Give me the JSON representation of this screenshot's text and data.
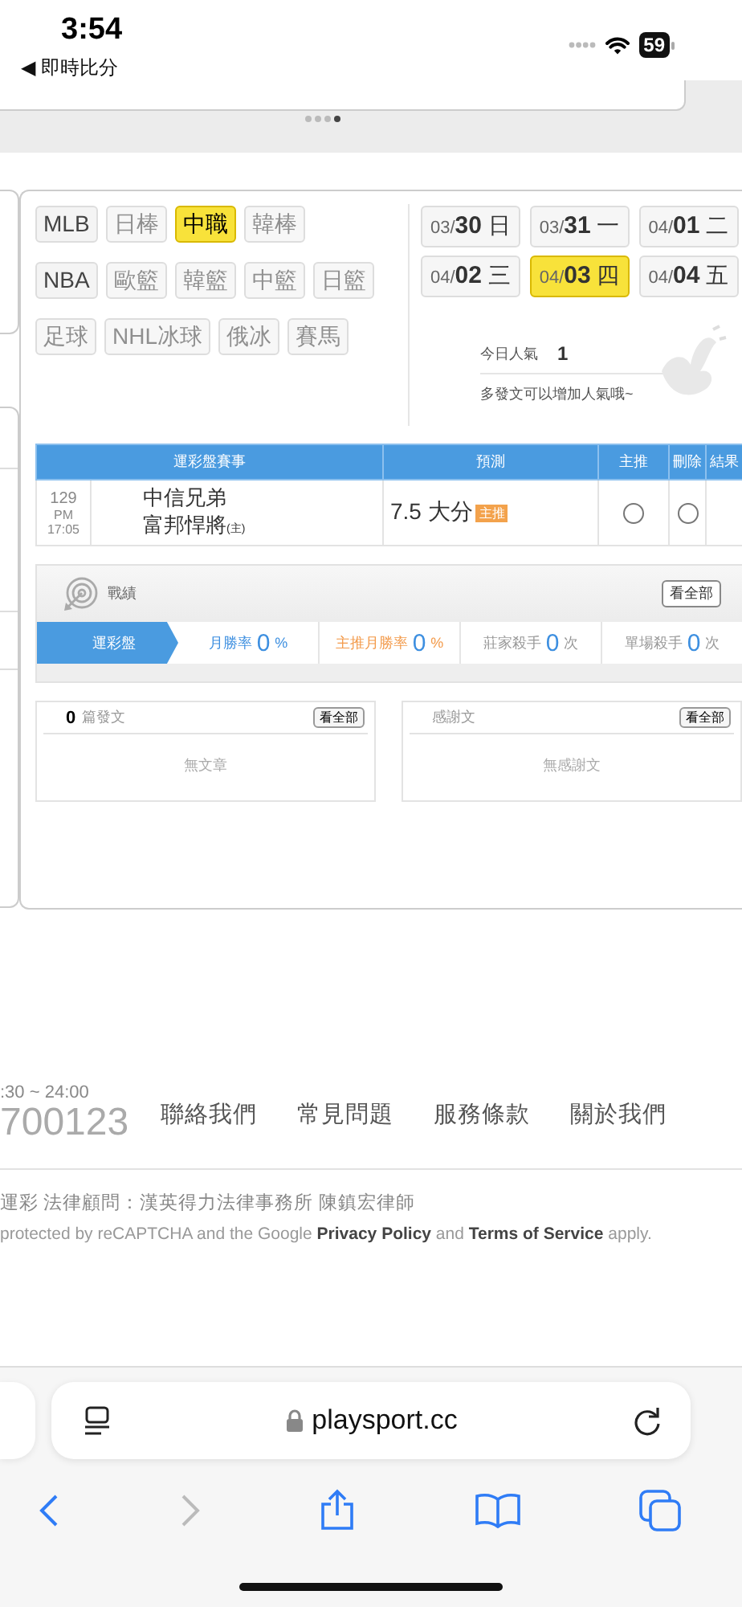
{
  "status_bar": {
    "time": "3:54",
    "back": "◀ 即時比分",
    "battery": "59"
  },
  "carousel": {
    "dots": [
      {
        "selected": false
      },
      {
        "selected": false
      },
      {
        "selected": false
      },
      {
        "selected": true
      }
    ]
  },
  "sports": [
    {
      "label": "MLB",
      "selected": false,
      "disabled": false
    },
    {
      "label": "日棒",
      "selected": false,
      "disabled": true
    },
    {
      "label": "中職",
      "selected": true,
      "disabled": false
    },
    {
      "label": "韓棒",
      "selected": false,
      "disabled": true
    },
    {
      "label": "NBA",
      "selected": false,
      "disabled": false
    },
    {
      "label": "歐籃",
      "selected": false,
      "disabled": true
    },
    {
      "label": "韓籃",
      "selected": false,
      "disabled": true
    },
    {
      "label": "中籃",
      "selected": false,
      "disabled": true
    },
    {
      "label": "日籃",
      "selected": false,
      "disabled": true
    },
    {
      "label": "足球",
      "selected": false,
      "disabled": true
    },
    {
      "label": "NHL冰球",
      "selected": false,
      "disabled": true
    },
    {
      "label": "俄冰",
      "selected": false,
      "disabled": true
    },
    {
      "label": "賽馬",
      "selected": false,
      "disabled": true
    }
  ],
  "dates": [
    {
      "month": "03/",
      "day": "30",
      "weekday": "日",
      "selected": false
    },
    {
      "month": "03/",
      "day": "31",
      "weekday": "一",
      "selected": false
    },
    {
      "month": "04/",
      "day": "01",
      "weekday": "二",
      "selected": false
    },
    {
      "month": "04/",
      "day": "02",
      "weekday": "三",
      "selected": false
    },
    {
      "month": "04/",
      "day": "03",
      "weekday": "四",
      "selected": true
    },
    {
      "month": "04/",
      "day": "04",
      "weekday": "五",
      "selected": false
    }
  ],
  "popularity": {
    "label": "今日人氣",
    "value": "1",
    "hint": "多發文可以增加人氣哦~"
  },
  "picks_table": {
    "columns": [
      "運彩盤賽事",
      "預測",
      "主推",
      "刪除",
      "結果"
    ],
    "rows": [
      {
        "number": "129",
        "time": "PM 17:05",
        "away": "中信兄弟",
        "home": "富邦悍將",
        "home_mark": "(主)",
        "prediction": "7.5 大分",
        "badge": "主推",
        "main_pick": false,
        "delete": false
      }
    ]
  },
  "record": {
    "title": "戰績",
    "view_all": "看全部",
    "tabs": [
      {
        "label": "運彩盤",
        "selected": true
      },
      {
        "label": "月勝率",
        "value": "0",
        "unit": "%",
        "color": "#3d8fe0",
        "selected": false
      },
      {
        "label": "主推月勝率",
        "value": "0",
        "unit": "%",
        "color": "#f39a4a",
        "selected": false
      },
      {
        "label": "莊家殺手",
        "value": "0",
        "unit": "次",
        "color": "#999999",
        "selected": false
      },
      {
        "label": "單場殺手",
        "value": "0",
        "unit": "次",
        "color": "#999999",
        "selected": false
      }
    ]
  },
  "posts": {
    "count": "0",
    "label": "篇發文",
    "view_all": "看全部",
    "empty": "無文章"
  },
  "thanks": {
    "title": "感謝文",
    "view_all": "看全部",
    "empty": "無感謝文"
  },
  "footer": {
    "hours": ":30 ~ 24:00",
    "phone": "700123",
    "links": [
      "聯絡我們",
      "常見問題",
      "服務條款",
      "關於我們"
    ],
    "legal": "運彩 法律顧問：漢英得力法律事務所 陳鎮宏律師",
    "recaptcha": "protected by reCAPTCHA and the Google **Privacy Policy** and **Terms of Service** apply."
  },
  "browser": {
    "url": "playsport.cc"
  }
}
